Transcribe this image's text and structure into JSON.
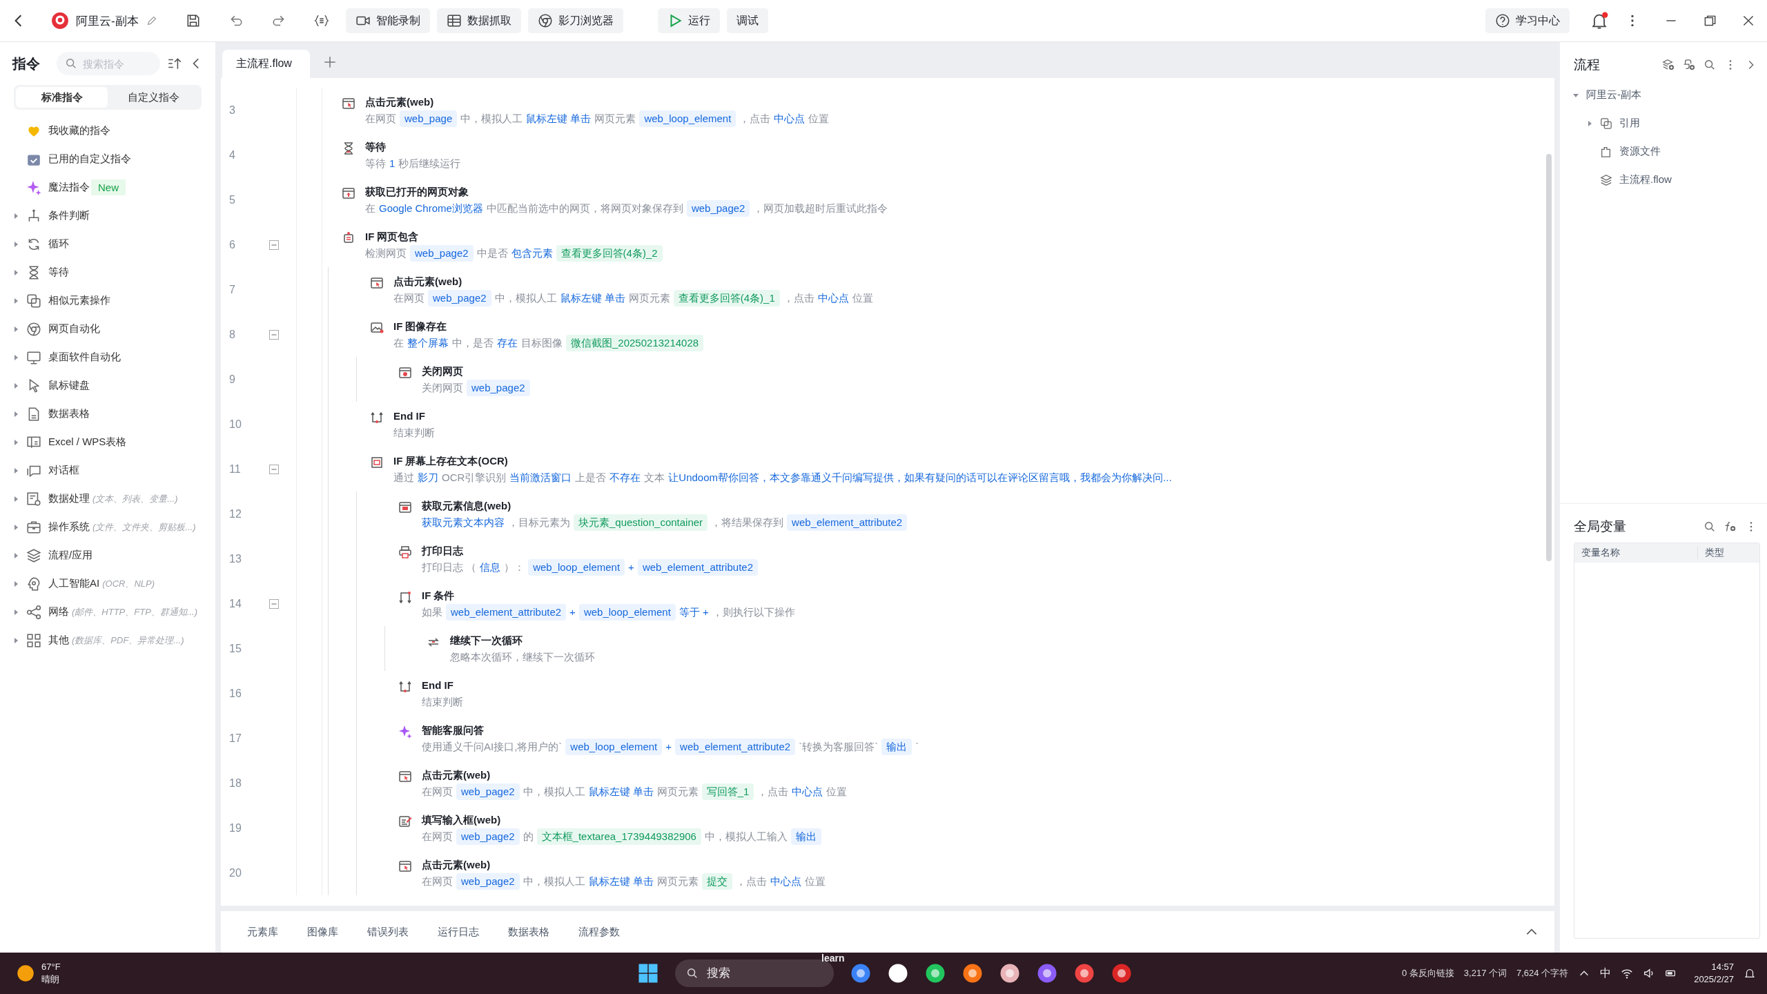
{
  "app": {
    "title": "阿里云-副本"
  },
  "toolbar": {
    "buttons": [
      {
        "label": "智能录制",
        "kind": "record"
      },
      {
        "label": "数据抓取",
        "kind": "grab"
      },
      {
        "label": "影刀浏览器",
        "kind": "browser"
      },
      {
        "label": "运行",
        "kind": "run"
      },
      {
        "label": "调试",
        "kind": "debug"
      }
    ],
    "help": "学习中心",
    "unread": true
  },
  "sidebar": {
    "title": "指令",
    "search": {
      "placeholder": "搜索指令"
    },
    "tabs": [
      {
        "label": "标准指令",
        "selected": true
      },
      {
        "label": "自定义指令",
        "selected": false
      }
    ],
    "items": [
      {
        "label": "我收藏的指令"
      },
      {
        "label": "已用的自定义指令"
      },
      {
        "label": "魔法指令",
        "badge": "New"
      },
      {
        "label": "条件判断",
        "expanded": false
      },
      {
        "label": "循环",
        "expanded": false
      },
      {
        "label": "等待",
        "expanded": false
      },
      {
        "label": "相似元素操作",
        "expanded": false
      },
      {
        "label": "网页自动化",
        "expanded": false
      },
      {
        "label": "桌面软件自动化",
        "expanded": false
      },
      {
        "label": "鼠标键盘",
        "expanded": false
      },
      {
        "label": "数据表格",
        "expanded": false
      },
      {
        "label": "Excel / WPS表格",
        "expanded": false
      },
      {
        "label": "对话框",
        "expanded": false
      },
      {
        "label": "数据处理",
        "hint": "(文本、列表、变量...)",
        "expanded": false
      },
      {
        "label": "操作系统",
        "hint": "(文件、文件夹、剪贴板...)",
        "expanded": false
      },
      {
        "label": "流程/应用",
        "expanded": false
      },
      {
        "label": "人工智能AI",
        "hint": "(OCR、NLP)",
        "expanded": false
      },
      {
        "label": "网络",
        "hint": "(邮件、HTTP、FTP、群通知...)",
        "expanded": false
      },
      {
        "label": "其他",
        "hint": "(数据库、PDF、异常处理...)",
        "expanded": false
      }
    ]
  },
  "editor": {
    "tabs": [
      {
        "label": "主流程.flow",
        "selected": true
      }
    ],
    "steps": [
      {
        "line": "3",
        "kind": "click",
        "title": "点击元素(web)",
        "desc": [
          {
            "text": "在网页",
            "kind": "text"
          },
          {
            "text": "web_page",
            "kind": "var"
          },
          {
            "text": "中，模拟人工",
            "kind": "text"
          },
          {
            "text": "鼠标左键 单击",
            "kind": "link"
          },
          {
            "text": "网页元素",
            "kind": "text"
          },
          {
            "text": "web_loop_element",
            "kind": "var"
          },
          {
            "text": "，点击",
            "kind": "text"
          },
          {
            "text": "中心点",
            "kind": "link"
          },
          {
            "text": "位置",
            "kind": "text"
          }
        ]
      },
      {
        "line": "4",
        "kind": "wait",
        "title": "等待",
        "desc": [
          {
            "text": "等待",
            "kind": "text"
          },
          {
            "text": "1",
            "kind": "link"
          },
          {
            "text": "秒后继续运行",
            "kind": "text"
          }
        ]
      },
      {
        "line": "5",
        "kind": "getpage",
        "title": "获取已打开的网页对象",
        "desc": [
          {
            "text": "在",
            "kind": "text"
          },
          {
            "text": "Google Chrome浏览器",
            "kind": "link"
          },
          {
            "text": "中匹配当前选中的网页，将网页对象保存到",
            "kind": "text"
          },
          {
            "text": "web_page2",
            "kind": "var"
          },
          {
            "text": "，网页加载超时后重试此指令",
            "kind": "text"
          }
        ]
      },
      {
        "line": "6",
        "kind": "if",
        "title": "IF 网页包含",
        "expanded": true,
        "desc": [
          {
            "text": "检测网页",
            "kind": "text"
          },
          {
            "text": "web_page2",
            "kind": "var"
          },
          {
            "text": "中是否",
            "kind": "text"
          },
          {
            "text": "包含元素",
            "kind": "link"
          },
          {
            "text": "查看更多回答(4条)_2",
            "kind": "elem"
          }
        ],
        "children": [
          {
            "line": "7",
            "kind": "click",
            "title": "点击元素(web)",
            "desc": [
              {
                "text": "在网页",
                "kind": "text"
              },
              {
                "text": "web_page2",
                "kind": "var"
              },
              {
                "text": "中，模拟人工",
                "kind": "text"
              },
              {
                "text": "鼠标左键 单击",
                "kind": "link"
              },
              {
                "text": "网页元素",
                "kind": "text"
              },
              {
                "text": "查看更多回答(4条)_1",
                "kind": "elem"
              },
              {
                "text": "，点击",
                "kind": "text"
              },
              {
                "text": "中心点",
                "kind": "link"
              },
              {
                "text": "位置",
                "kind": "text"
              }
            ]
          },
          {
            "line": "8",
            "kind": "ifimage",
            "title": "IF 图像存在",
            "expanded": true,
            "desc": [
              {
                "text": "在",
                "kind": "text"
              },
              {
                "text": "整个屏幕",
                "kind": "link"
              },
              {
                "text": "中，是否",
                "kind": "text"
              },
              {
                "text": "存在",
                "kind": "link"
              },
              {
                "text": "目标图像",
                "kind": "text"
              },
              {
                "text": "微信截图_20250213214028",
                "kind": "elem"
              }
            ],
            "children": [
              {
                "line": "9",
                "kind": "close",
                "title": "关闭网页",
                "desc": [
                  {
                    "text": "关闭网页",
                    "kind": "text"
                  },
                  {
                    "text": "web_page2",
                    "kind": "var"
                  }
                ]
              }
            ]
          },
          {
            "line": "10",
            "kind": "endif",
            "title": "End IF",
            "desc": [
              {
                "text": "结束判断",
                "kind": "text"
              }
            ]
          },
          {
            "line": "11",
            "kind": "ifocr",
            "title": "IF 屏幕上存在文本(OCR)",
            "expanded": true,
            "desc": [
              {
                "text": "通过",
                "kind": "text"
              },
              {
                "text": "影刀",
                "kind": "link"
              },
              {
                "text": "OCR引擎识别",
                "kind": "text"
              },
              {
                "text": "当前激活窗口",
                "kind": "link"
              },
              {
                "text": "上是否",
                "kind": "text"
              },
              {
                "text": "不存在",
                "kind": "link"
              },
              {
                "text": "文本",
                "kind": "text"
              },
              {
                "text": "让Undoom帮你回答，本文参靠通义千问编写提供，如果有疑问的话可以在评论区留言哦，我都会为你解决问...",
                "kind": "link"
              }
            ],
            "children": [
              {
                "line": "12",
                "kind": "getinfo",
                "title": "获取元素信息(web)",
                "desc": [
                  {
                    "text": "获取元素文本内容",
                    "kind": "link"
                  },
                  {
                    "text": "，目标元素为",
                    "kind": "text"
                  },
                  {
                    "text": "块元素_question_container",
                    "kind": "elem"
                  },
                  {
                    "text": "，将结果保存到",
                    "kind": "text"
                  },
                  {
                    "text": "web_element_attribute2",
                    "kind": "var"
                  }
                ]
              },
              {
                "line": "13",
                "kind": "log",
                "title": "打印日志",
                "desc": [
                  {
                    "text": "打印日志 （",
                    "kind": "text"
                  },
                  {
                    "text": "信息",
                    "kind": "link"
                  },
                  {
                    "text": "）：",
                    "kind": "text"
                  },
                  {
                    "text": "web_loop_element",
                    "kind": "var"
                  },
                  {
                    "text": "+",
                    "kind": "link"
                  },
                  {
                    "text": "web_element_attribute2",
                    "kind": "var"
                  }
                ]
              },
              {
                "line": "14",
                "kind": "ifcond",
                "title": "IF 条件",
                "expanded": true,
                "desc": [
                  {
                    "text": "如果",
                    "kind": "text"
                  },
                  {
                    "text": "web_element_attribute2",
                    "kind": "var"
                  },
                  {
                    "text": "+",
                    "kind": "link"
                  },
                  {
                    "text": "web_loop_element",
                    "kind": "var"
                  },
                  {
                    "text": "等于 +",
                    "kind": "link"
                  },
                  {
                    "text": "，则执行以下操作",
                    "kind": "text"
                  }
                ],
                "children": [
                  {
                    "line": "15",
                    "kind": "continue",
                    "title": "继续下一次循环",
                    "desc": [
                      {
                        "text": "忽略本次循环，继续下一次循环",
                        "kind": "text"
                      }
                    ]
                  }
                ]
              },
              {
                "line": "16",
                "kind": "endif",
                "title": "End IF",
                "desc": [
                  {
                    "text": "结束判断",
                    "kind": "text"
                  }
                ]
              },
              {
                "line": "17",
                "kind": "ai",
                "title": "智能客服问答",
                "desc": [
                  {
                    "text": "使用通义千问AI接口,将用户的`",
                    "kind": "text"
                  },
                  {
                    "text": "web_loop_element",
                    "kind": "var"
                  },
                  {
                    "text": "+",
                    "kind": "link"
                  },
                  {
                    "text": "web_element_attribute2",
                    "kind": "var"
                  },
                  {
                    "text": "`转换为客服回答`",
                    "kind": "text"
                  },
                  {
                    "text": "输出",
                    "kind": "var"
                  },
                  {
                    "text": "`",
                    "kind": "text"
                  }
                ]
              },
              {
                "line": "18",
                "kind": "click",
                "title": "点击元素(web)",
                "desc": [
                  {
                    "text": "在网页",
                    "kind": "text"
                  },
                  {
                    "text": "web_page2",
                    "kind": "var"
                  },
                  {
                    "text": "中，模拟人工",
                    "kind": "text"
                  },
                  {
                    "text": "鼠标左键 单击",
                    "kind": "link"
                  },
                  {
                    "text": "网页元素",
                    "kind": "text"
                  },
                  {
                    "text": "写回答_1",
                    "kind": "elem"
                  },
                  {
                    "text": "，点击",
                    "kind": "text"
                  },
                  {
                    "text": "中心点",
                    "kind": "link"
                  },
                  {
                    "text": "位置",
                    "kind": "text"
                  }
                ]
              },
              {
                "line": "19",
                "kind": "fill",
                "title": "填写输入框(web)",
                "desc": [
                  {
                    "text": "在网页",
                    "kind": "text"
                  },
                  {
                    "text": "web_page2",
                    "kind": "var"
                  },
                  {
                    "text": "的",
                    "kind": "text"
                  },
                  {
                    "text": "文本框_textarea_1739449382906",
                    "kind": "elem"
                  },
                  {
                    "text": "中，模拟人工输入",
                    "kind": "text"
                  },
                  {
                    "text": "输出",
                    "kind": "var"
                  }
                ]
              },
              {
                "line": "20",
                "kind": "click",
                "title": "点击元素(web)",
                "desc": [
                  {
                    "text": "在网页",
                    "kind": "text"
                  },
                  {
                    "text": "web_page2",
                    "kind": "var"
                  },
                  {
                    "text": "中，模拟人工",
                    "kind": "text"
                  },
                  {
                    "text": "鼠标左键 单击",
                    "kind": "link"
                  },
                  {
                    "text": "网页元素",
                    "kind": "text"
                  },
                  {
                    "text": "提交",
                    "kind": "elem"
                  },
                  {
                    "text": "，点击",
                    "kind": "text"
                  },
                  {
                    "text": "中心点",
                    "kind": "link"
                  },
                  {
                    "text": "位置",
                    "kind": "text"
                  }
                ]
              }
            ]
          }
        ]
      }
    ]
  },
  "bottom_tabs": [
    "元素库",
    "图像库",
    "错误列表",
    "运行日志",
    "数据表格",
    "流程参数"
  ],
  "flow_panel": {
    "title": "流程",
    "tree": [
      {
        "label": "阿里云-副本",
        "expanded": true,
        "children": [
          {
            "label": "引用",
            "expanded": false
          },
          {
            "label": "资源文件"
          },
          {
            "label": "主流程.flow"
          }
        ]
      }
    ]
  },
  "variables": {
    "title": "全局变量",
    "columns": [
      "变量名称",
      "类型"
    ]
  },
  "taskbar": {
    "weather": {
      "temp": "67°F",
      "condition": "晴朗"
    },
    "search": {
      "placeholder": "搜索"
    },
    "overlay_title": "learn",
    "status": [
      "0 条反向链接",
      "3,217 个词",
      "7,624 个字符"
    ],
    "ime": "中",
    "time": "14:57",
    "date": "2025/2/27"
  }
}
